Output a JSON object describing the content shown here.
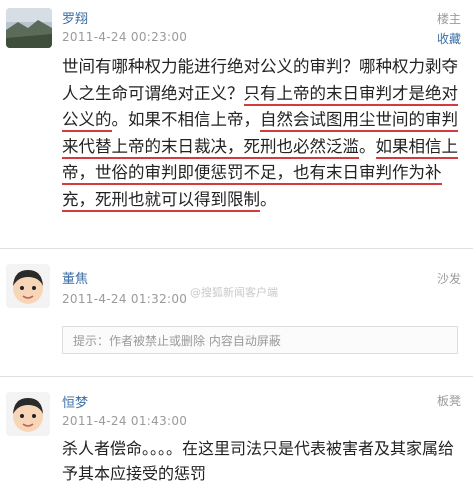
{
  "posts": [
    {
      "author": "罗翔",
      "time": "2011-4-24 00:23:00",
      "role": "楼主",
      "favorite": "收藏",
      "segments": [
        {
          "text": "世间有哪种权力能进行绝对公义的审判？哪种权力剥夺人之生命可谓绝对正义？",
          "underline": false
        },
        {
          "text": "只有上帝的末日审判才是绝对公义的",
          "underline": true
        },
        {
          "text": "。如果不相信上帝，",
          "underline": false
        },
        {
          "text": "自然会试图用尘世间的审判来代替上帝的末日裁决，死刑也必然泛滥",
          "underline": true
        },
        {
          "text": "。",
          "underline": false
        },
        {
          "text": "如果相信上帝，世俗的审判即便惩罚不足，也有末日审判作为补充，死刑也就可以得到限制",
          "underline": true
        },
        {
          "text": "。",
          "underline": false
        }
      ]
    },
    {
      "author": "董焦",
      "time": "2011-4-24 01:32:00",
      "role": "沙发",
      "notice": "提示：作者被禁止或删除 内容自动屏蔽"
    },
    {
      "author": "恒梦",
      "time": "2011-4-24 01:43:00",
      "role": "板凳",
      "text": "杀人者偿命。。。。在这里司法只是代表被害者及其家属给予其本应接受的惩罚"
    }
  ],
  "watermark": "@搜狐新闻客户端",
  "colors": {
    "link": "#3a6ea5",
    "muted": "#9a9a9a",
    "underline": "#d23c3c"
  }
}
